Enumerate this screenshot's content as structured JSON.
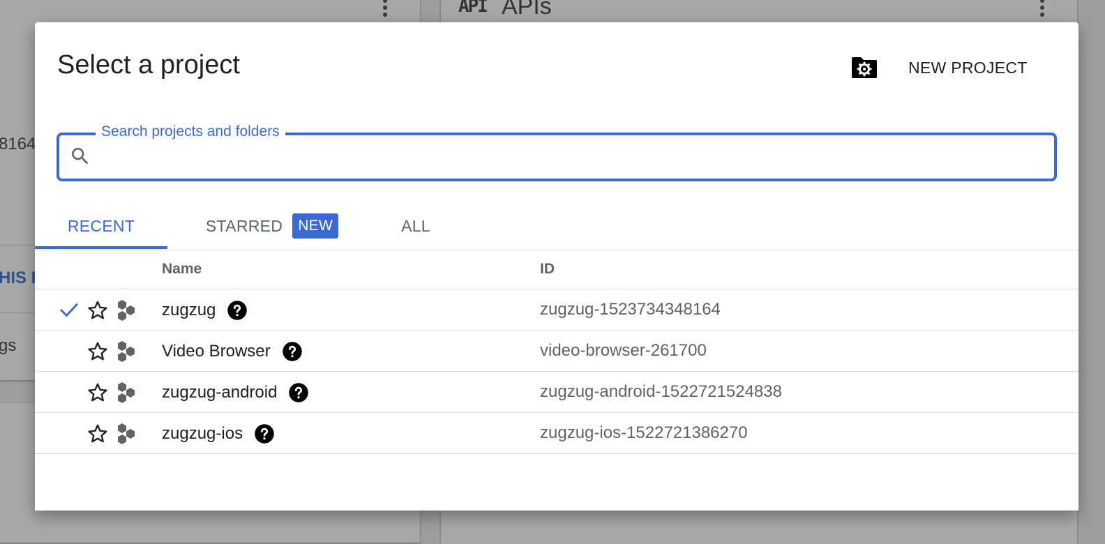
{
  "background": {
    "api_icon_label": "API",
    "apis_title": "APIs",
    "partial_number": "8164",
    "partial_link": "HIS P",
    "partial_settings": "gs"
  },
  "dialog": {
    "title": "Select a project",
    "manage_folder_icon": "folder-gear-icon",
    "new_project_label": "NEW PROJECT"
  },
  "search": {
    "label": "Search projects and folders",
    "value": "",
    "placeholder": ""
  },
  "tabs": [
    {
      "label": "RECENT",
      "active": true
    },
    {
      "label": "STARRED",
      "badge": "NEW",
      "active": false
    },
    {
      "label": "ALL",
      "active": false
    }
  ],
  "table": {
    "columns": [
      "Name",
      "ID"
    ],
    "rows": [
      {
        "name": "zugzug",
        "id": "zugzug-1523734348164",
        "selected": true,
        "starred": false
      },
      {
        "name": "Video Browser",
        "id": "video-browser-261700",
        "selected": false,
        "starred": false
      },
      {
        "name": "zugzug-android",
        "id": "zugzug-android-1522721524838",
        "selected": false,
        "starred": false
      },
      {
        "name": "zugzug-ios",
        "id": "zugzug-ios-1522721386270",
        "selected": false,
        "starred": false
      }
    ]
  },
  "colors": {
    "accent": "#3a6bd3",
    "text_primary": "#202124",
    "text_secondary": "#5f6368",
    "scrim": "#9e9e9e"
  }
}
